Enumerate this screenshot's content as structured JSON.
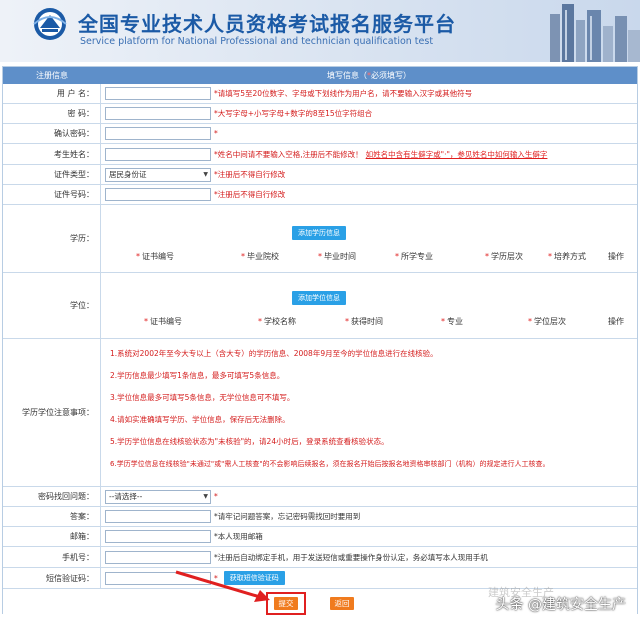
{
  "header": {
    "title_cn": "全国专业技术人员资格考试报名服务平台",
    "title_en": "Service platform for National Professional and technician  qualification test"
  },
  "table_head": {
    "col_left": "注册信息",
    "col_right_prefix": "填写信息（",
    "col_right_req": "*",
    "col_right_suffix": "必须填写）"
  },
  "rows": {
    "username": {
      "label": "用 户 名：",
      "hint": "*请填写5至20位数字、字母或下划线作为用户名，请不要输入汉字或其他符号"
    },
    "password": {
      "label": "密    码：",
      "hint": "*大写字母+小写字母+数字的8至15位字符组合"
    },
    "confirm": {
      "label": "确认密码：",
      "hint": "*"
    },
    "name": {
      "label": "考生姓名：",
      "hint": "*姓名中间请不要输入空格,注册后不能修改！",
      "link": "如姓名中含有生僻字或\"·\"，参见姓名中如何输入生僻字"
    },
    "id_type": {
      "label": "证件类型：",
      "selected": "居民身份证",
      "hint": "*注册后不得自行修改"
    },
    "id_number": {
      "label": "证件号码：",
      "hint": "*注册后不得自行修改"
    }
  },
  "education": {
    "label": "学历：",
    "add_button": "添加学历信息",
    "columns": [
      "证书编号",
      "毕业院校",
      "毕业时间",
      "所学专业",
      "学历层次",
      "培养方式"
    ],
    "action_col": "操作"
  },
  "degree": {
    "label": "学位：",
    "add_button": "添加学位信息",
    "columns": [
      "证书编号",
      "学校名称",
      "获得时间",
      "专业",
      "学位层次"
    ],
    "action_col": "操作"
  },
  "notes": {
    "label": "学历学位注意事项：",
    "items": [
      "1.系统对2002年至今大专以上（含大专）的学历信息、2008年9月至今的学位信息进行在线核验。",
      "2.学历信息最少填写1条信息，最多可填写5条信息。",
      "3.学位信息最多可填写5条信息，无学位信息可不填写。",
      "4.请如实准确填写学历、学位信息，保存后无法删除。",
      "5.学历学位信息在线核验状态为\"未核验\"的，请24小时后，登录系统查看核验状态。",
      "6.学历学位信息在线核验\"未通过\"或\"需人工核查\"的不会影响后续报名，须在报名开始后按报名地资格审核部门（机构）的规定进行人工核查。"
    ]
  },
  "security": {
    "question": {
      "label": "密码找回问题：",
      "selected": "--请选择--",
      "hint": "*"
    },
    "answer": {
      "label": "答案：",
      "hint": "*请牢记问题答案，忘记密码需找回时要用到"
    },
    "email": {
      "label": "邮箱：",
      "hint": "*本人现用邮箱"
    },
    "phone": {
      "label": "手机号：",
      "hint": "*注册后自动绑定手机，用于发送短信或重要操作身份认定，务必填写本人现用手机"
    },
    "sms": {
      "label": "短信验证码：",
      "hint": "*",
      "button": "获取短信验证码"
    }
  },
  "actions": {
    "submit": "提交",
    "back": "返回"
  },
  "watermark": {
    "text": "头条 @建筑安全生产",
    "ghost": "建筑安全生产"
  },
  "colors": {
    "header_blue": "#5e8fc9",
    "accent_red": "#e01e1e",
    "button_blue": "#2aa0e6",
    "button_orange": "#f07b1e"
  }
}
